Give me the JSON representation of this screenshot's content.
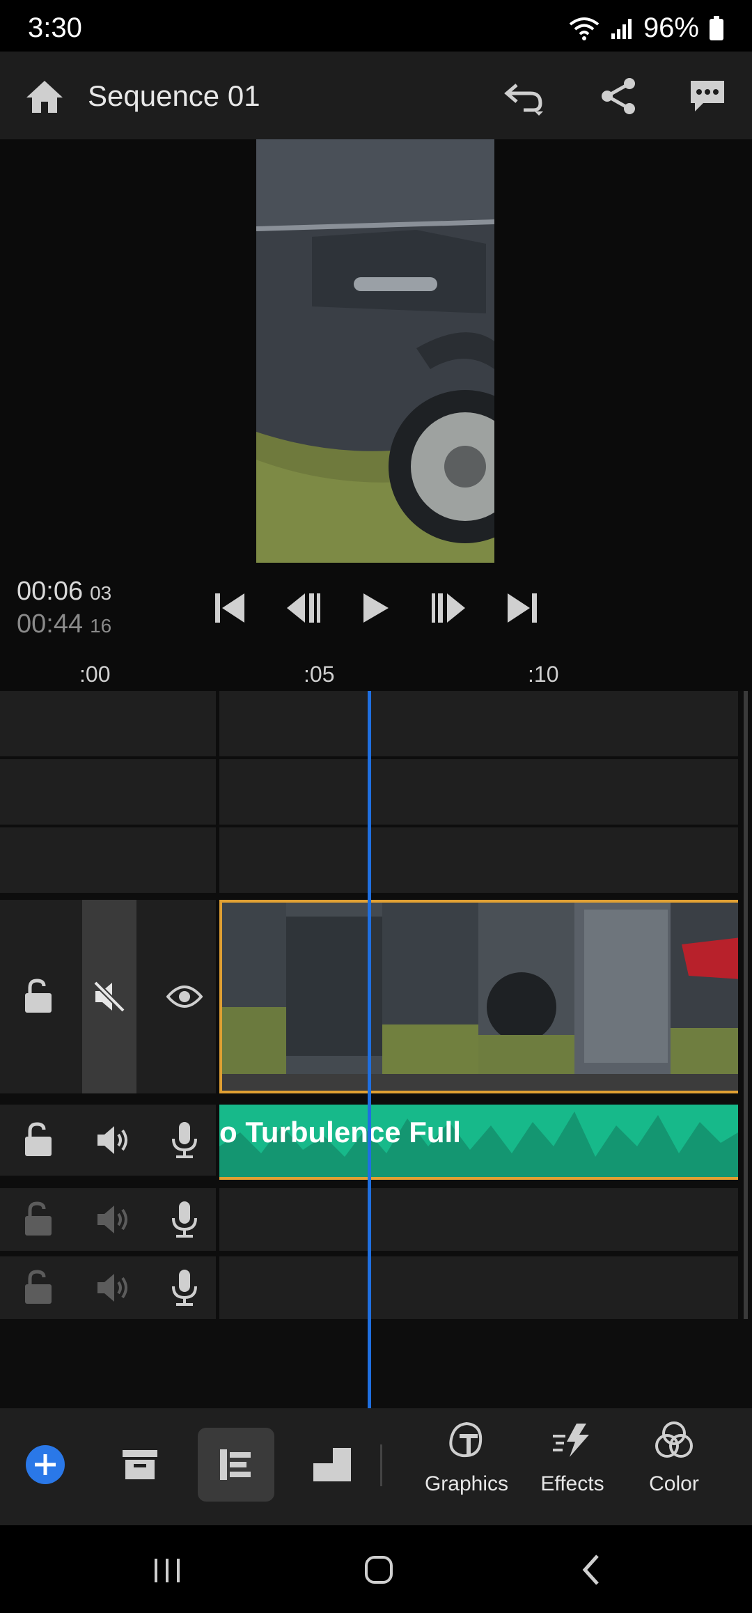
{
  "status": {
    "time": "3:30",
    "battery": "96%"
  },
  "header": {
    "title": "Sequence 01"
  },
  "player": {
    "current_time": "00:06",
    "current_frame": "03",
    "duration": "00:44",
    "duration_frame": "16"
  },
  "ruler": {
    "ticks": [
      ":00",
      ":05",
      ":10"
    ]
  },
  "tracks": {
    "audio_clip_label": "o Turbulence Full"
  },
  "toolbar": {
    "graphics": "Graphics",
    "effects": "Effects",
    "color": "Color"
  },
  "colors": {
    "accent": "#1f6fe0",
    "audio_clip": "#17b98a",
    "clip_border": "#e0a033"
  }
}
